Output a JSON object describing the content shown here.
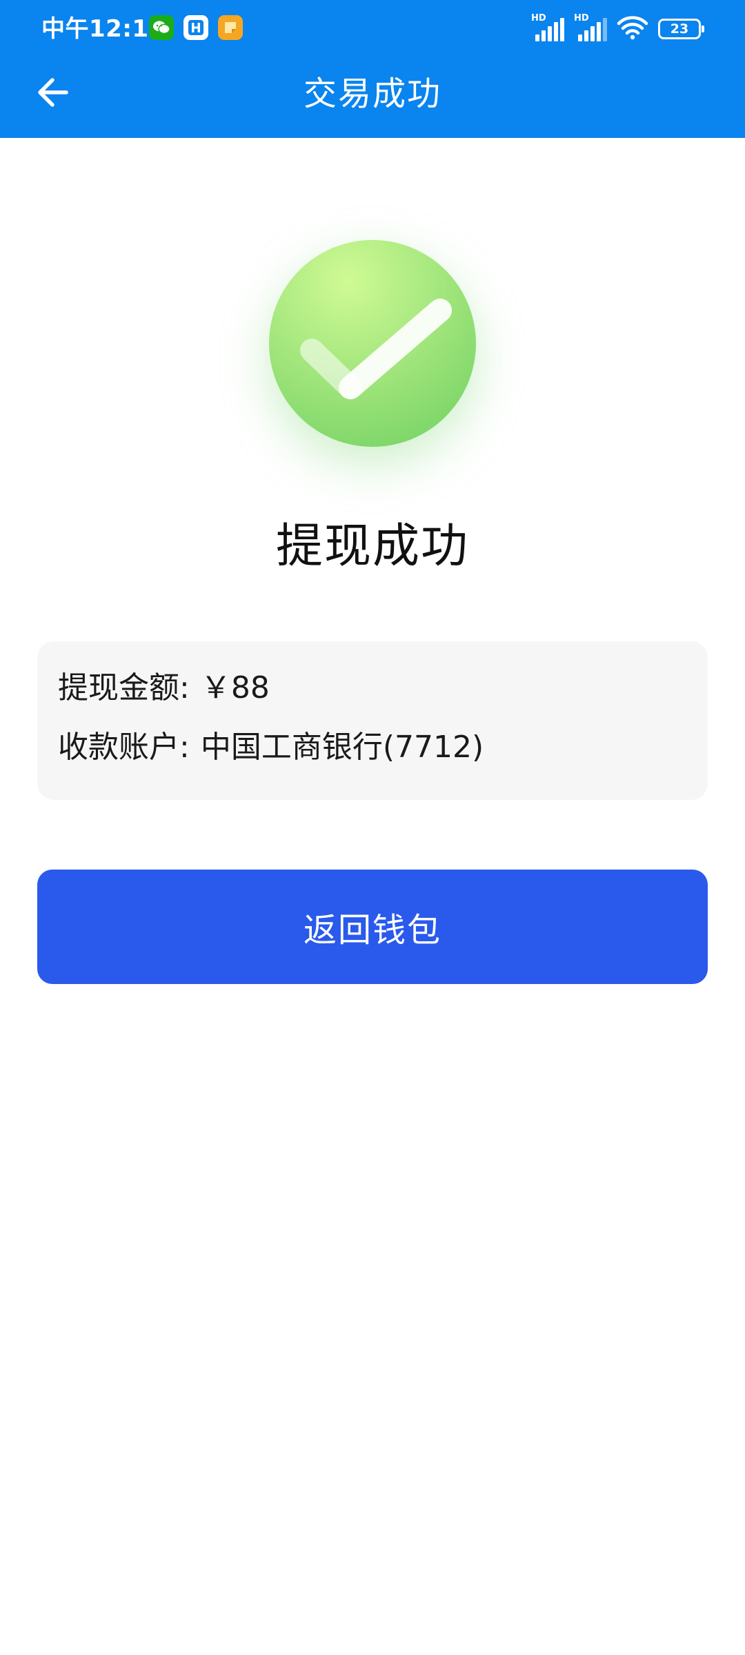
{
  "status_bar": {
    "time": "中午12:18",
    "apps": [
      "wechat-icon",
      "h-app-icon",
      "notes-icon"
    ],
    "signal_1_label": "HD",
    "signal_2_label": "HD",
    "battery": "23"
  },
  "nav": {
    "back_icon": "arrow-left-icon",
    "title": "交易成功"
  },
  "result": {
    "icon": "check-circle-icon",
    "title": "提现成功"
  },
  "details": {
    "amount_label": "提现金额:",
    "amount_value": "￥88",
    "account_label": "收款账户:",
    "account_value": "中国工商银行(7712)"
  },
  "actions": {
    "return_wallet_label": "返回钱包"
  },
  "colors": {
    "header": "#0a84ee",
    "primary_button": "#2a5aec",
    "success_green": "#8fdc70",
    "card_bg": "#f6f6f6"
  }
}
